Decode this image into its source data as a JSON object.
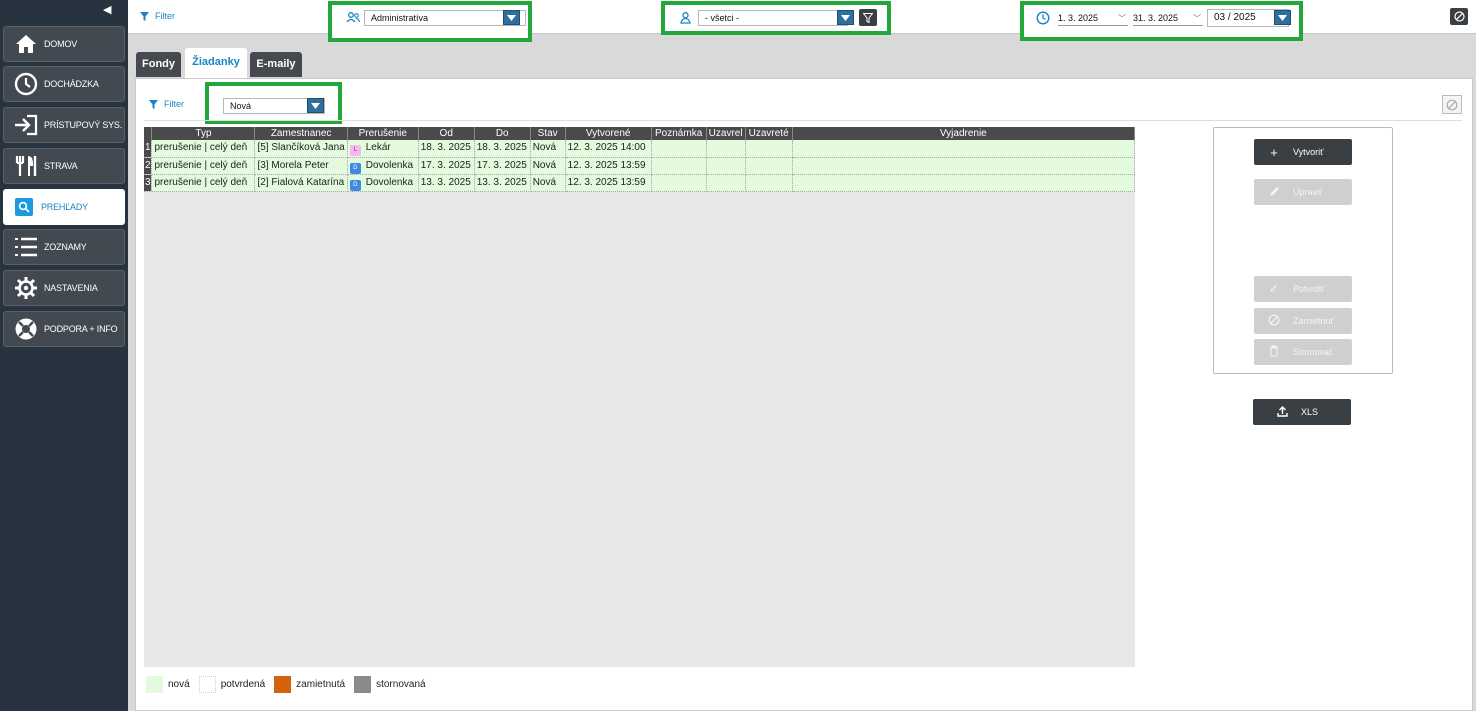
{
  "colors": {
    "sidebar_bg": "#27343f",
    "accent_blue": "#1a84c7",
    "highlight_green": "#22a83a",
    "row_new": "#e2fbdc",
    "dark_button": "#3a3f44",
    "tag_lekar": "#f5b8f0",
    "tag_dovolenka": "#3d8be0",
    "legend_zamietnuta": "#d4620a",
    "legend_stornovana": "#8a8a8a"
  },
  "sidebar": {
    "items": [
      {
        "label": "DOMOV",
        "icon": "home-icon"
      },
      {
        "label": "DOCHÁDZKA",
        "icon": "clock-icon"
      },
      {
        "label": "PRÍSTUPOVÝ SYS.",
        "icon": "login-arrow-icon"
      },
      {
        "label": "STRAVA",
        "icon": "cutlery-icon"
      },
      {
        "label": "PREHĽADY",
        "icon": "search-icon"
      },
      {
        "label": "ZOZNAMY",
        "icon": "list-icon"
      },
      {
        "label": "NASTAVENIA",
        "icon": "gear-icon"
      },
      {
        "label": "PODPORA + INFO",
        "icon": "lifebuoy-icon"
      }
    ],
    "active_index": 4
  },
  "topbar": {
    "filter_label": "Filter",
    "department_value": "Administratíva",
    "employee_value": "- všetci -",
    "date_from": "1. 3. 2025",
    "date_to": "31. 3. 2025",
    "period_value": "03 / 2025"
  },
  "tabs": [
    {
      "label": "Fondy",
      "active": false
    },
    {
      "label": "Žiadanky",
      "active": true
    },
    {
      "label": "E-maily",
      "active": false
    }
  ],
  "panel": {
    "filter_label": "Filter",
    "status_filter_value": "Nová"
  },
  "table": {
    "columns": [
      "Typ",
      "Zamestnanec",
      "Prerušenie",
      "Od",
      "Do",
      "Stav",
      "Vytvorené",
      "Poznámka",
      "Uzavrel",
      "Uzavreté",
      "Vyjadrenie"
    ],
    "rows": [
      {
        "n": "1",
        "typ": "prerušenie | celý deň",
        "zamestnanec": "[5] Slančíková Jana",
        "tag": "L",
        "tag_color": "#f5b8f0",
        "prerusenie": "Lekár",
        "od": "18. 3. 2025",
        "do": "18. 3. 2025",
        "stav": "Nová",
        "vytvorene": "12. 3. 2025  14:00",
        "poznamka": "",
        "uzavrel": "",
        "uzavrete": "",
        "vyjadrenie": ""
      },
      {
        "n": "2",
        "typ": "prerušenie | celý deň",
        "zamestnanec": "[3] Morela Peter",
        "tag": "D",
        "tag_color": "#3d8be0",
        "prerusenie": "Dovolenka",
        "od": "17. 3. 2025",
        "do": "17. 3. 2025",
        "stav": "Nová",
        "vytvorene": "12. 3. 2025  13:59",
        "poznamka": "",
        "uzavrel": "",
        "uzavrete": "",
        "vyjadrenie": ""
      },
      {
        "n": "3",
        "typ": "prerušenie | celý deň",
        "zamestnanec": "[2] Fialová Katarína",
        "tag": "D",
        "tag_color": "#3d8be0",
        "prerusenie": "Dovolenka",
        "od": "13. 3. 2025",
        "do": "13. 3. 2025",
        "stav": "Nová",
        "vytvorene": "12. 3. 2025  13:59",
        "poznamka": "",
        "uzavrel": "",
        "uzavrete": "",
        "vyjadrenie": ""
      }
    ]
  },
  "legend": [
    {
      "label": "nová",
      "color": "#e2fbdc"
    },
    {
      "label": "potvrdená",
      "color": "#ffffff"
    },
    {
      "label": "zamietnutá",
      "color": "#d4620a"
    },
    {
      "label": "stornovaná",
      "color": "#8a8a8a"
    }
  ],
  "actions": {
    "create": {
      "label": "Vytvoriť",
      "icon": "plus-icon"
    },
    "edit": {
      "label": "Upraviť",
      "icon": "pencil-icon"
    },
    "confirm": {
      "label": "Potvrdiť",
      "icon": "check-icon"
    },
    "reject": {
      "label": "Zamietnuť",
      "icon": "ban-icon"
    },
    "cancel": {
      "label": "Stornovať",
      "icon": "trash-icon"
    },
    "export": {
      "label": "XLS",
      "icon": "upload-icon"
    }
  }
}
